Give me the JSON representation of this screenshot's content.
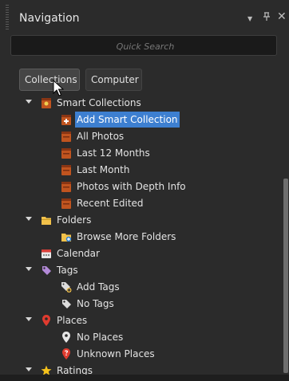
{
  "panel": {
    "title": "Navigation",
    "controls": {
      "menu": "▼",
      "pin": "ᵖ",
      "close": "✕"
    }
  },
  "search": {
    "placeholder": "Quick Search",
    "value": ""
  },
  "tabs": [
    {
      "label": "Collections",
      "active": true
    },
    {
      "label": "Computer",
      "active": false
    }
  ],
  "tree": {
    "smart_collections": {
      "label": "Smart Collections",
      "icon": "smart-collection-icon",
      "items": [
        {
          "label": "Add Smart Collection",
          "icon": "add-smart-collection-icon",
          "selected": true
        },
        {
          "label": "All Photos",
          "icon": "collection-icon"
        },
        {
          "label": "Last 12 Months",
          "icon": "collection-icon"
        },
        {
          "label": "Last Month",
          "icon": "collection-icon"
        },
        {
          "label": "Photos with Depth Info",
          "icon": "collection-icon"
        },
        {
          "label": "Recent Edited",
          "icon": "collection-icon"
        }
      ]
    },
    "folders": {
      "label": "Folders",
      "icon": "folder-icon",
      "items": [
        {
          "label": "Browse More Folders",
          "icon": "folder-add-icon"
        }
      ]
    },
    "calendar": {
      "label": "Calendar",
      "icon": "calendar-icon"
    },
    "tags": {
      "label": "Tags",
      "icon": "tag-icon",
      "items": [
        {
          "label": "Add Tags",
          "icon": "tag-add-icon"
        },
        {
          "label": "No Tags",
          "icon": "tag-icon"
        }
      ]
    },
    "places": {
      "label": "Places",
      "icon": "map-pin-icon",
      "items": [
        {
          "label": "No Places",
          "icon": "map-pin-icon"
        },
        {
          "label": "Unknown Places",
          "icon": "map-pin-unknown-icon"
        }
      ]
    },
    "ratings": {
      "label": "Ratings",
      "icon": "star-icon"
    }
  },
  "colors": {
    "panel_bg": "#2b2b2b",
    "selection": "#3d7fd0",
    "collection_icon": "#c0541f",
    "folder_icon": "#f2c14a",
    "tag_icon": "#b38ad8",
    "place_icon": "#e03b2f",
    "star_icon": "#f5c21b"
  }
}
